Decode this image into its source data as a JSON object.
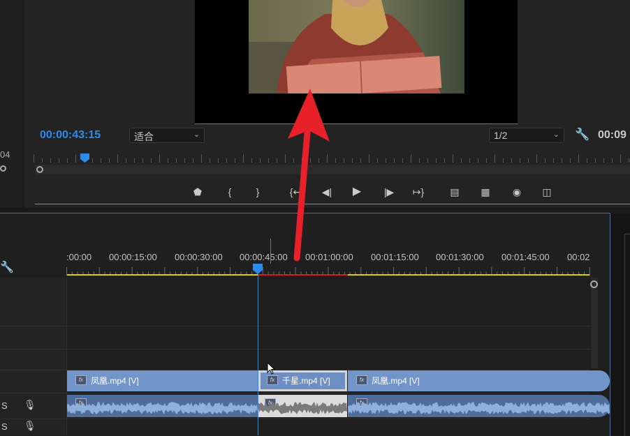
{
  "monitor": {
    "timecode_current": "00:00:43:15",
    "fit_label": "适合",
    "resolution_label": "1/2",
    "timecode_duration": "00:09",
    "left_edge_value": "04"
  },
  "timeline": {
    "ruler_labels": [
      ":00:00",
      "00:00:15:00",
      "00:00:30:00",
      "00:00:45:00",
      "00:01:00:00",
      "00:01:15:00",
      "00:01:30:00",
      "00:01:45:00",
      "00:02"
    ],
    "track_labels": [
      "S",
      "S"
    ],
    "video_clips": [
      {
        "label": "凤凰.mp4 [V]"
      },
      {
        "label": "千星.mp4 [V]"
      },
      {
        "label": "凤凰.mp4 [V]"
      }
    ],
    "fx_label": "fx"
  },
  "colors": {
    "accent": "#2d8ceb",
    "annotation_arrow": "#e8202a",
    "clip_video": "#7194c9",
    "clip_audio": "#4f6d9b"
  }
}
